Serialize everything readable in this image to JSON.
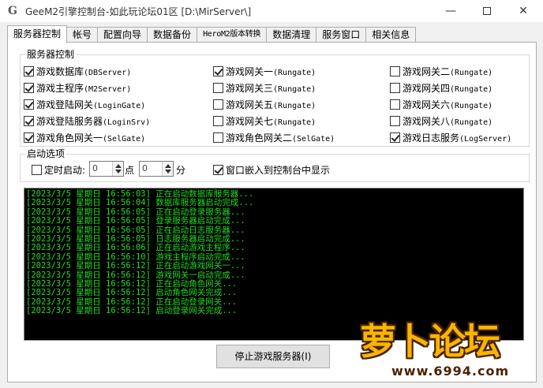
{
  "window": {
    "title": "GeeM2引擎控制台-如此玩论坛01区 [D:\\MirServer\\]",
    "icon": "G"
  },
  "tabs": [
    {
      "label": "服务器控制",
      "active": true
    },
    {
      "label": "帐号"
    },
    {
      "label": "配置向导"
    },
    {
      "label": "数据备份"
    },
    {
      "label": "HeroM2版本转换"
    },
    {
      "label": "数据清理"
    },
    {
      "label": "服务窗口"
    },
    {
      "label": "相关信息"
    }
  ],
  "server_control": {
    "group_title": "服务器控制",
    "items": [
      {
        "label": "游戏数据库",
        "en": "(DBServer)",
        "checked": true
      },
      {
        "label": "游戏网关一",
        "en": "(Rungate)",
        "checked": true
      },
      {
        "label": "游戏网关二",
        "en": "(Rungate)",
        "checked": false
      },
      {
        "label": "游戏主程序",
        "en": "(M2Server)",
        "checked": true
      },
      {
        "label": "游戏网关三",
        "en": "(Rungate)",
        "checked": false
      },
      {
        "label": "游戏网关四",
        "en": "(Rungate)",
        "checked": false
      },
      {
        "label": "游戏登陆网关",
        "en": "(LoginGate)",
        "checked": true
      },
      {
        "label": "游戏网关五",
        "en": "(Rungate)",
        "checked": false
      },
      {
        "label": "游戏网关六",
        "en": "(Rungate)",
        "checked": false
      },
      {
        "label": "游戏登陆服务器",
        "en": "(LoginSrv)",
        "checked": true
      },
      {
        "label": "游戏网关七",
        "en": "(Rungate)",
        "checked": false
      },
      {
        "label": "游戏网关八",
        "en": "(Rungate)",
        "checked": false
      },
      {
        "label": "游戏角色网关一",
        "en": "(SelGate)",
        "checked": true
      },
      {
        "label": "游戏角色网关二",
        "en": "(SelGate)",
        "checked": false
      },
      {
        "label": "游戏日志服务",
        "en": "(LogServer)",
        "checked": true
      }
    ]
  },
  "startup": {
    "group_title": "启动选项",
    "timed_start_label": "定时启动:",
    "timed_start_checked": false,
    "hour_value": "0",
    "point_label": "点",
    "minute_value": "0",
    "minute_label": "分",
    "embed_label": "窗口嵌入到控制台中显示",
    "embed_checked": true
  },
  "log": [
    "[2023/3/5 星期日 16:56:03] 正在启动数据库服务器...",
    "[2023/3/5 星期日 16:56:04] 数据库服务器启动完成...",
    "[2023/3/5 星期日 16:56:05] 正在启动登录服务器...",
    "[2023/3/5 星期日 16:56:05] 登录服务器启动完成...",
    "[2023/3/5 星期日 16:56:05] 正在启动日志服务器...",
    "[2023/3/5 星期日 16:56:05] 日志服务器启动完成...",
    "[2023/3/5 星期日 16:56:06] 正在启动游戏主程序...",
    "[2023/3/5 星期日 16:56:10] 游戏主程序启动完成...",
    "[2023/3/5 星期日 16:56:12] 正在启动游戏网关一...",
    "[2023/3/5 星期日 16:56:12] 游戏网关一启动完成...",
    "[2023/3/5 星期日 16:56:12] 正在启动角色网关...",
    "[2023/3/5 星期日 16:56:12] 启动角色网关完成...",
    "[2023/3/5 星期日 16:56:12] 正在启动登录网关...",
    "[2023/3/5 星期日 16:56:12] 启动登录网关完成..."
  ],
  "stop_button": "停止游戏服务器(I)",
  "watermark": {
    "text": "萝卜论坛",
    "url": "www.6994.com"
  },
  "colors": {
    "log_text": "#22dd22",
    "log_bg": "#000000",
    "watermark_fill": "#f7b500"
  }
}
